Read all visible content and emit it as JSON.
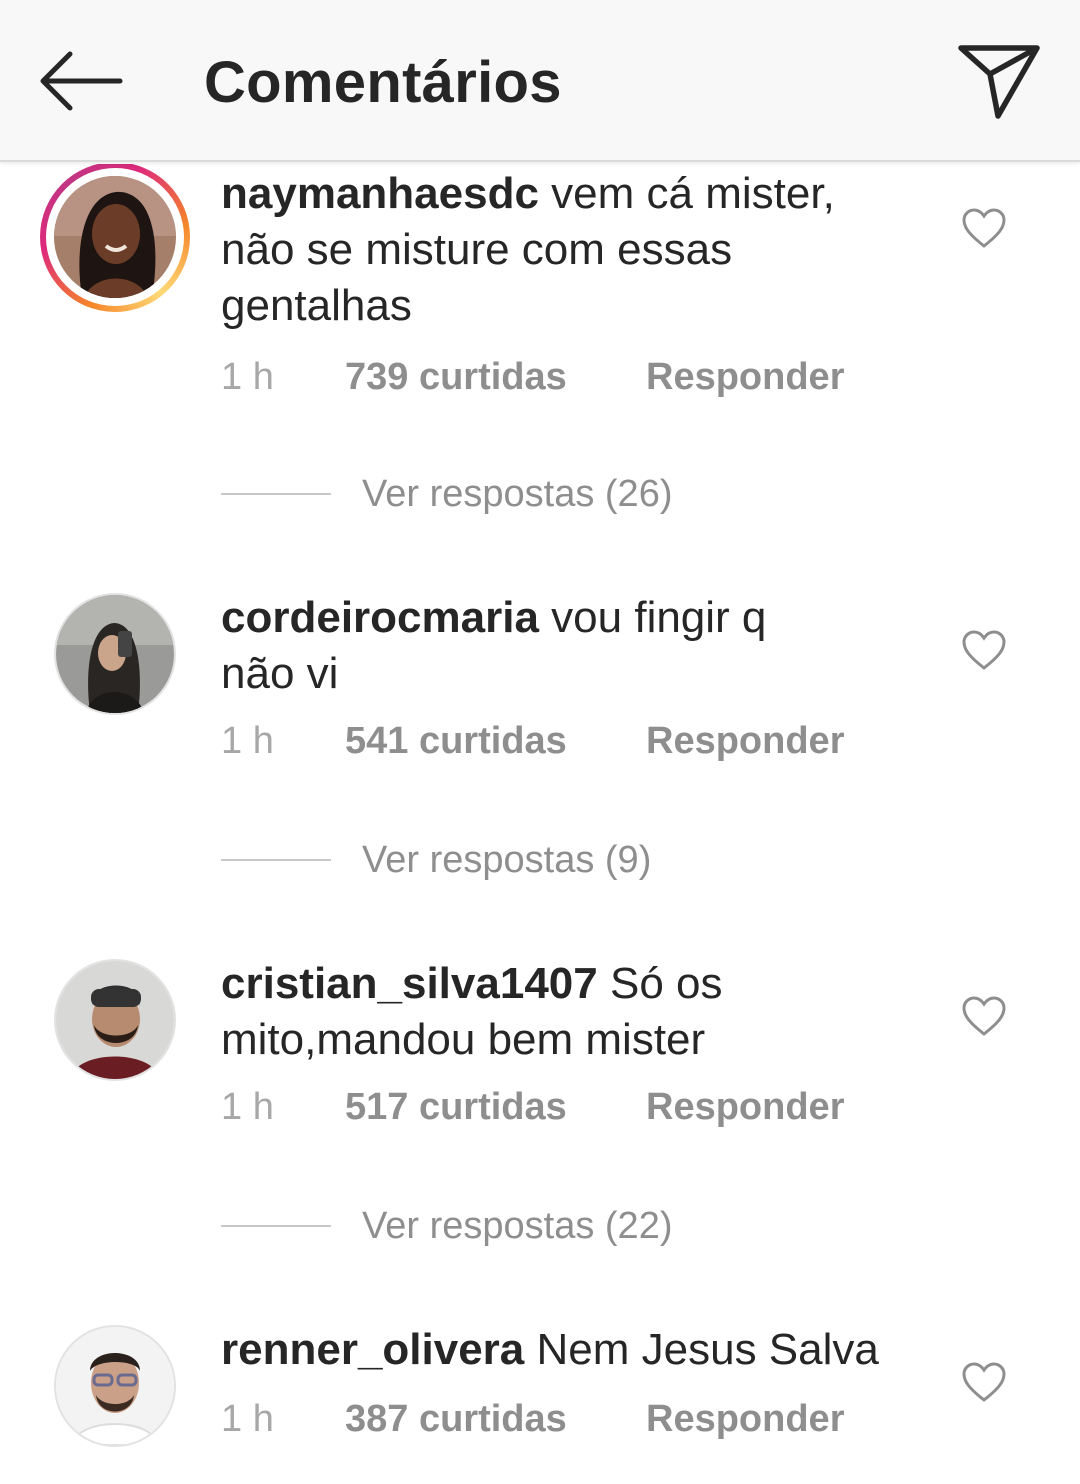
{
  "header": {
    "title": "Comentários",
    "back_icon": "arrow-left-icon",
    "share_icon": "paper-plane-icon"
  },
  "comments": [
    {
      "username": "naymanhaesdc",
      "text": "vem cá mister, não se misture com essas gentalhas",
      "time": "1 h",
      "likes": "739 curtidas",
      "reply": "Responder",
      "view_replies": "Ver respostas (26)",
      "has_story": true
    },
    {
      "username": "cordeirocmaria",
      "text": "vou fingir q não vi",
      "time": "1 h",
      "likes": "541 curtidas",
      "reply": "Responder",
      "view_replies": "Ver respostas (9)",
      "has_story": false
    },
    {
      "username": "cristian_silva1407",
      "text": "Só os mito,mandou bem mister",
      "time": "1 h",
      "likes": "517 curtidas",
      "reply": "Responder",
      "view_replies": "Ver respostas (22)",
      "has_story": false
    },
    {
      "username": "renner_olivera",
      "text": "Nem Jesus Salva",
      "time": "1 h",
      "likes": "387 curtidas",
      "reply": "Responder",
      "has_story": false
    }
  ],
  "colors": {
    "primary_text": "#262626",
    "secondary_text": "#8e8e8e",
    "header_bg": "#f8f8f8"
  }
}
